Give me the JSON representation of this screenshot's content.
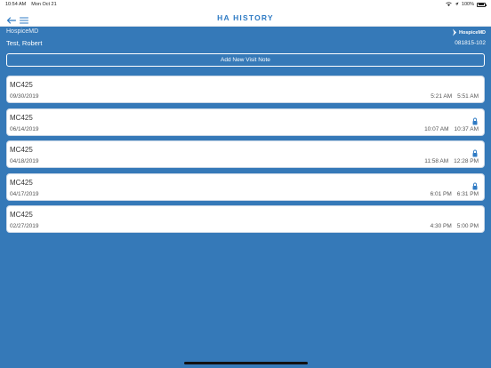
{
  "status_bar": {
    "time": "10:54 AM",
    "date": "Mon Oct 21",
    "battery": "100%"
  },
  "nav": {
    "title": "HA HISTORY"
  },
  "header": {
    "organization": "HospiceMD",
    "patient": "Test, Robert",
    "logo_text": "HospiceMD",
    "patient_id": "081815-102"
  },
  "add_button": {
    "label": "Add New Visit Note"
  },
  "visits": [
    {
      "code": "MC425",
      "date": "09/30/2019",
      "start": "5:21 AM",
      "end": "5:51 AM",
      "locked": false
    },
    {
      "code": "MC425",
      "date": "06/14/2019",
      "start": "10:07 AM",
      "end": "10:37 AM",
      "locked": true
    },
    {
      "code": "MC425",
      "date": "04/18/2019",
      "start": "11:58 AM",
      "end": "12:28 PM",
      "locked": true
    },
    {
      "code": "MC425",
      "date": "04/17/2019",
      "start": "6:01 PM",
      "end": "6:31 PM",
      "locked": true
    },
    {
      "code": "MC425",
      "date": "02/27/2019",
      "start": "4:30 PM",
      "end": "5:00 PM",
      "locked": false
    }
  ],
  "colors": {
    "background": "#3579b8",
    "accent": "#2f7bc4",
    "card": "#ffffff"
  },
  "icons": {
    "back": "arrow-left-icon",
    "menu": "hamburger-menu-icon",
    "lock": "lock-icon",
    "logo": "hospicemd-logo-icon",
    "wifi": "wifi-icon",
    "location": "location-arrow-icon",
    "battery": "battery-icon"
  }
}
